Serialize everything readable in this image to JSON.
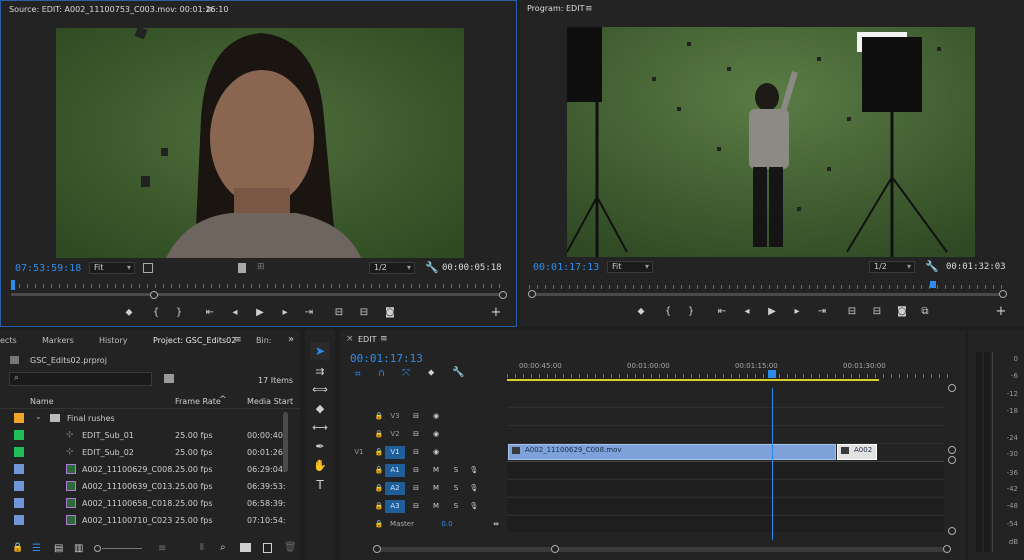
{
  "source": {
    "title": "Source: EDIT: A002_11100753_C003.mov: 00:01:26:10",
    "menu_icon": "hamburger-icon",
    "timecode_in": "07:53:59:18",
    "fit": "Fit",
    "res": "1/2",
    "timecode_dur": "00:00:05:18"
  },
  "program": {
    "title": "Program: EDIT",
    "menu_icon": "hamburger-icon",
    "timecode_in": "00:01:17:13",
    "fit": "Fit",
    "res": "1/2",
    "timecode_dur": "00:01:32:03"
  },
  "project": {
    "tabs": [
      "ects",
      "Markers",
      "History",
      "Project: GSC_Edits02",
      "Bin:"
    ],
    "file": "GSC_Edits02.prproj",
    "items_count": "17 Items",
    "columns": [
      "Name",
      "Frame Rate",
      "Media Start"
    ],
    "rows": [
      {
        "name": "Final rushes",
        "rate": "",
        "start": "",
        "color": "#f0a22a",
        "type": "folder"
      },
      {
        "name": "EDIT_Sub_01",
        "rate": "25.00 fps",
        "start": "00:00:40:",
        "color": "#1fbe5a",
        "type": "seq"
      },
      {
        "name": "EDIT_Sub_02",
        "rate": "25.00 fps",
        "start": "00:01:26:",
        "color": "#1fbe5a",
        "type": "seq"
      },
      {
        "name": "A002_11100629_C008.",
        "rate": "25.00 fps",
        "start": "06:29:04:",
        "color": "#6f96d8",
        "type": "clip"
      },
      {
        "name": "A002_11100639_C013.",
        "rate": "25.00 fps",
        "start": "06:39:53:",
        "color": "#6f96d8",
        "type": "clip"
      },
      {
        "name": "A002_11100658_C018.",
        "rate": "25.00 fps",
        "start": "06:58:39:",
        "color": "#6f96d8",
        "type": "clip"
      },
      {
        "name": "A002_11100710_C023",
        "rate": "25.00 fps",
        "start": "07:10:54:",
        "color": "#6f96d8",
        "type": "clip"
      }
    ]
  },
  "timeline": {
    "tab": "EDIT",
    "timecode": "00:01:17:13",
    "ruler_labels": [
      "00:00:45:00",
      "00:01:00:00",
      "00:01:15:00",
      "00:01:30:00"
    ],
    "tracks": {
      "v3": "V3",
      "v2": "V2",
      "v1": "V1",
      "v1_src": "V1",
      "a1": "A1",
      "a2": "A2",
      "a3": "A3",
      "master": "Master",
      "master_val": "0.0",
      "m": "M",
      "s": "S"
    },
    "clip1": "A002_11100629_C008.mov",
    "clip2": "A002"
  },
  "vu": {
    "ticks": [
      "0",
      "-6",
      "-12",
      "-18",
      "-24",
      "-30",
      "-36",
      "-42",
      "-48",
      "-54",
      "dB"
    ]
  },
  "colors": {
    "accent": "#2d8ceb",
    "clip": "#7da2d9",
    "playhead": "#2d8ceb",
    "green_screen": "#3a5a2e"
  }
}
